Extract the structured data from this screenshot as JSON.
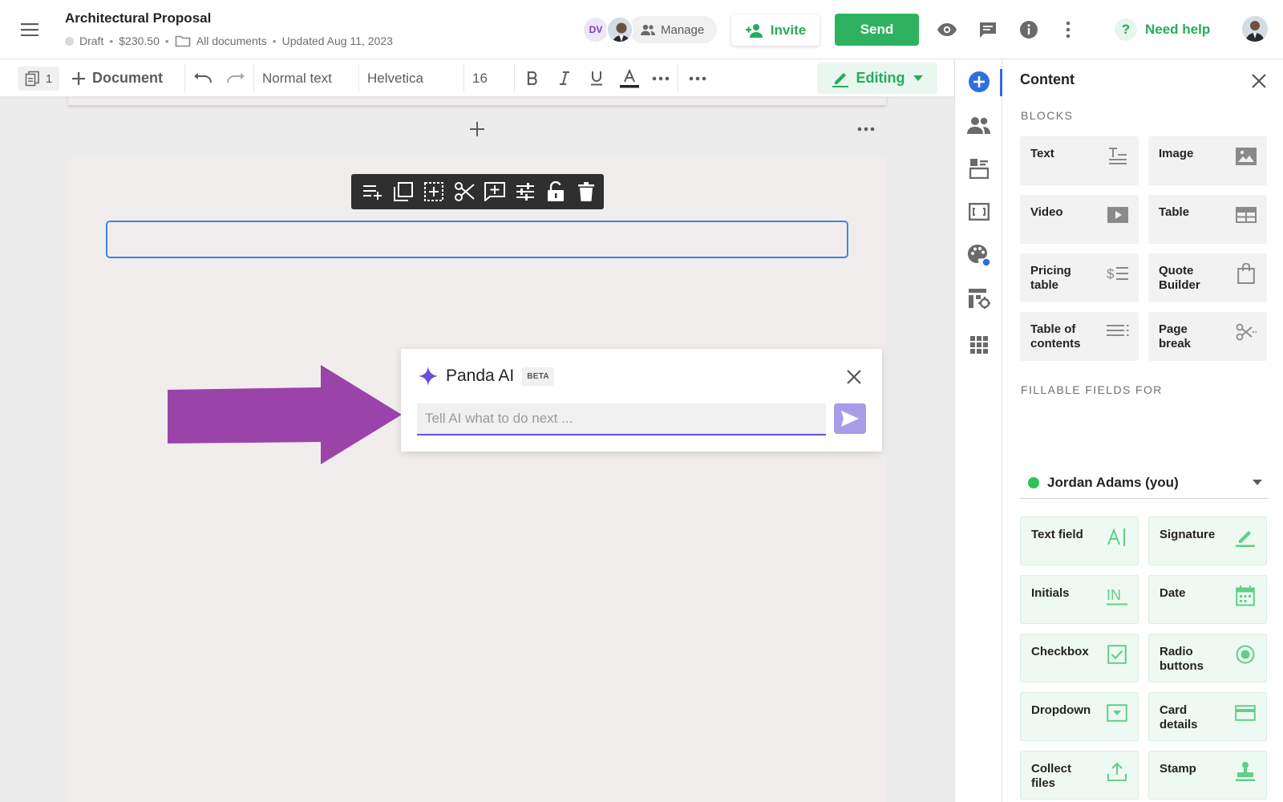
{
  "header": {
    "title": "Architectural Proposal",
    "status": "Draft",
    "price": "$230.50",
    "folder": "All documents",
    "updated": "Updated Aug 11, 2023",
    "avatar_initials": "DV",
    "manage_label": "Manage",
    "invite_label": "Invite",
    "send_label": "Send",
    "help_label": "Need help",
    "help_glyph": "?",
    "separator": "•"
  },
  "toolbar": {
    "page_count": "1",
    "add_document_label": "Document",
    "style_value": "Normal text",
    "font_value": "Helvetica",
    "size_value": "16",
    "editing_label": "Editing"
  },
  "ai": {
    "title": "Panda AI",
    "badge": "BETA",
    "placeholder": "Tell AI what to do next ..."
  },
  "panel": {
    "title": "Content",
    "blocks_heading": "BLOCKS",
    "blocks": [
      {
        "label": "Text",
        "icon": "text-block-icon"
      },
      {
        "label": "Image",
        "icon": "image-icon"
      },
      {
        "label": "Video",
        "icon": "video-icon"
      },
      {
        "label": "Table",
        "icon": "table-icon"
      },
      {
        "label": "Pricing table",
        "icon": "pricing-table-icon"
      },
      {
        "label": "Quote Builder",
        "icon": "shopping-bag-icon"
      },
      {
        "label": "Table of contents",
        "icon": "list-icon"
      },
      {
        "label": "Page break",
        "icon": "scissors-icon"
      }
    ],
    "fillable_heading": "FILLABLE FIELDS FOR",
    "recipient": "Jordan Adams (you)",
    "fields": [
      {
        "label": "Text field",
        "icon": "text-field-icon"
      },
      {
        "label": "Signature",
        "icon": "pen-icon"
      },
      {
        "label": "Initials",
        "icon": "initials-icon"
      },
      {
        "label": "Date",
        "icon": "calendar-icon"
      },
      {
        "label": "Checkbox",
        "icon": "checkbox-icon"
      },
      {
        "label": "Radio buttons",
        "icon": "radio-icon"
      },
      {
        "label": "Dropdown",
        "icon": "dropdown-icon"
      },
      {
        "label": "Card details",
        "icon": "credit-card-icon"
      },
      {
        "label": "Collect files",
        "icon": "upload-icon"
      },
      {
        "label": "Stamp",
        "icon": "stamp-icon"
      }
    ]
  },
  "colors": {
    "accent_green": "#2eb260",
    "selection_blue": "#3f83e4",
    "ai_purple": "#6a4fd6",
    "arrow_purple": "#9a44aa"
  }
}
